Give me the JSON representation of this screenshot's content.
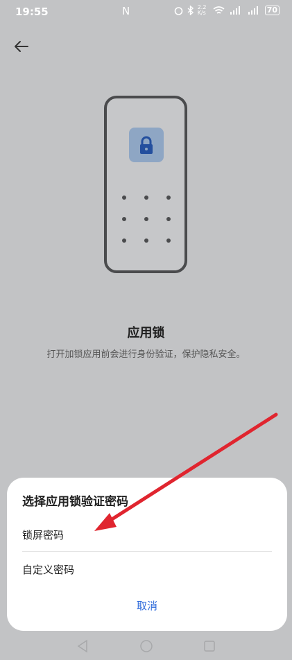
{
  "status_bar": {
    "time": "19:55",
    "nfc_icon": "N",
    "network_speed": "2.2 K/s",
    "battery": "70"
  },
  "nav": {
    "back_icon": "arrow-left-icon"
  },
  "illustration": {
    "icon": "lock-icon"
  },
  "page": {
    "title": "应用锁",
    "description": "打开加锁应用前会进行身份验证，保护隐私安全。"
  },
  "sheet": {
    "title": "选择应用锁验证密码",
    "options": [
      "锁屏密码",
      "自定义密码"
    ],
    "cancel_label": "取消"
  },
  "colors": {
    "background": "#c2c3c5",
    "accent": "#2f6bdb",
    "annotation_arrow": "#e0252f"
  }
}
